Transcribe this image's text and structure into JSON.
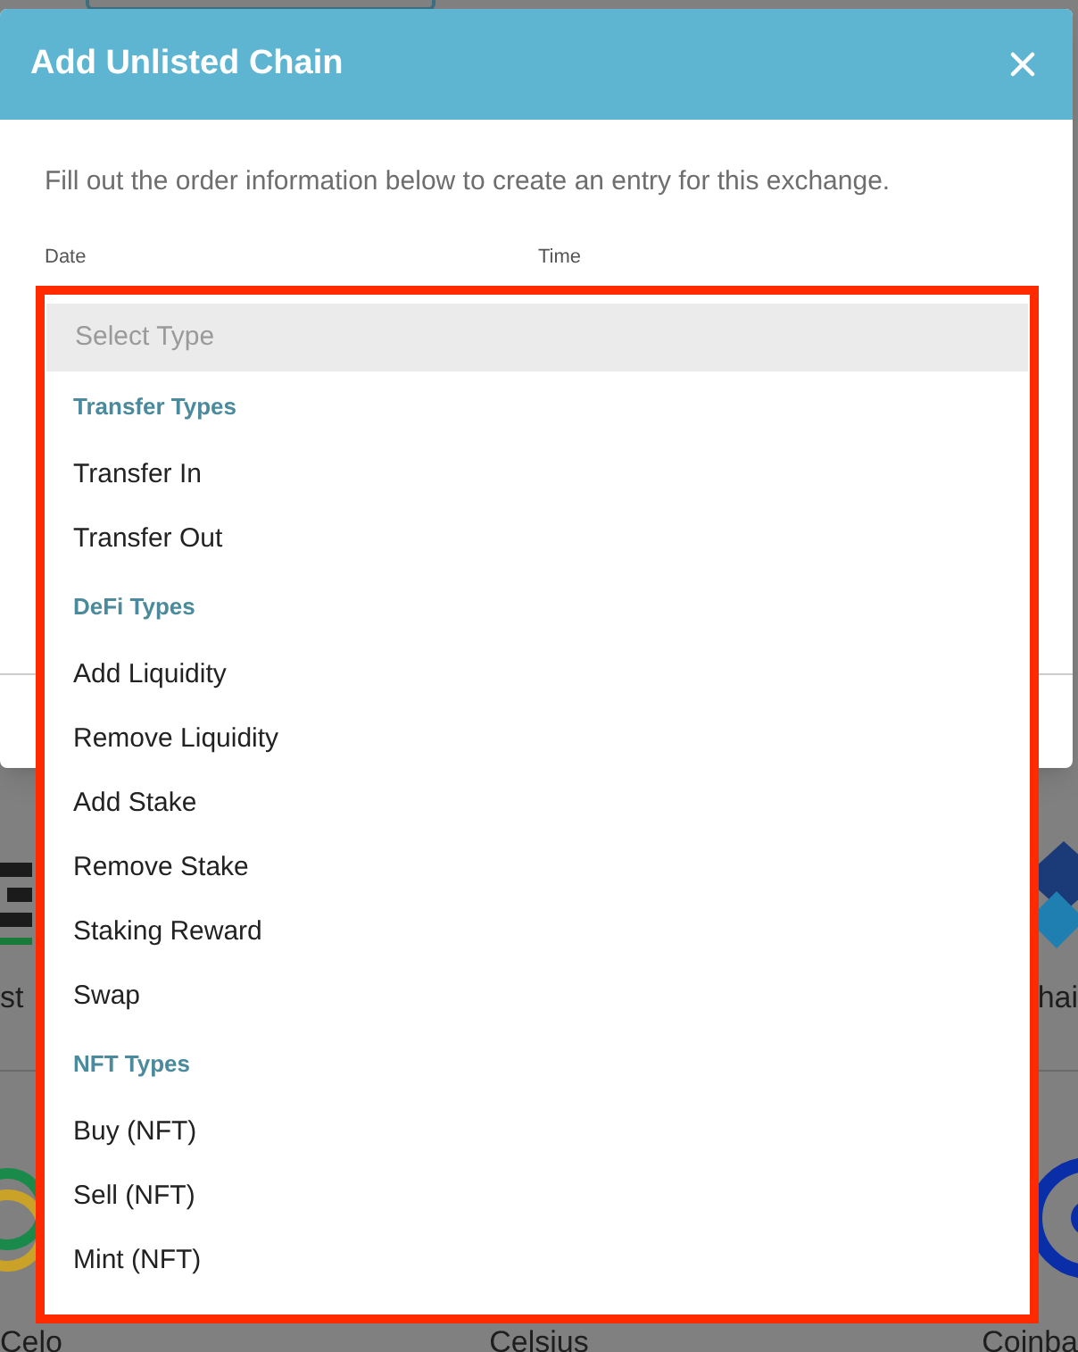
{
  "background": {
    "cards": [
      {
        "label": "st",
        "kind": "bars"
      },
      {
        "label": "hai",
        "kind": "diamond"
      },
      {
        "label": "Celo",
        "kind": "rings"
      },
      {
        "label": "Celsius",
        "kind": "none"
      },
      {
        "label": "Coinba",
        "kind": "coin"
      }
    ]
  },
  "dialog": {
    "title": "Add Unlisted Chain",
    "description": "Fill out the order information below to create an entry for this exchange.",
    "fields": [
      {
        "label": "Date"
      },
      {
        "label": "Time"
      }
    ],
    "dropdown": {
      "placeholder": "Select Type",
      "placeholder_highlighted": true,
      "groups": [
        {
          "title": "Transfer Types",
          "options": [
            "Transfer In",
            "Transfer Out"
          ]
        },
        {
          "title": "DeFi Types",
          "options": [
            "Add Liquidity",
            "Remove Liquidity",
            "Add Stake",
            "Remove Stake",
            "Staking Reward",
            "Swap"
          ]
        },
        {
          "title": "NFT Types",
          "options": [
            "Buy (NFT)",
            "Sell (NFT)",
            "Mint (NFT)"
          ]
        }
      ]
    }
  }
}
